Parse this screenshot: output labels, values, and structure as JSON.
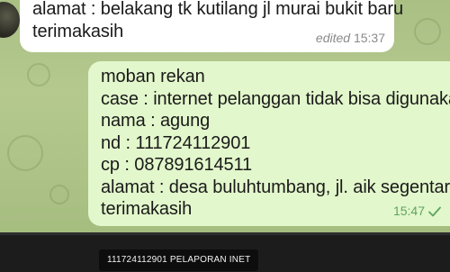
{
  "incoming_message": {
    "lines": [
      "alamat : belakang tk kutilang jl murai bukit baru",
      "terimakasih"
    ],
    "edited_label": "edited",
    "time": "15:37"
  },
  "outgoing_message": {
    "lines": [
      "moban rekan",
      "case : internet pelanggan tidak bisa digunakan",
      "nama : agung",
      "nd : 111724112901",
      "cp : 087891614511",
      "alamat :  desa buluhtumbang, jl. aik segentar",
      "terimakasih"
    ],
    "time": "15:47",
    "status_icon": "single-check-icon"
  },
  "caption": {
    "text": "111724112901 PELAPORAN INET"
  },
  "colors": {
    "wallpaper": "#b1c68c",
    "incoming_bubble": "#ffffff",
    "outgoing_bubble": "#e2f7cb",
    "outgoing_meta": "#5fa463",
    "bottom_bar": "#1c1c1c"
  }
}
